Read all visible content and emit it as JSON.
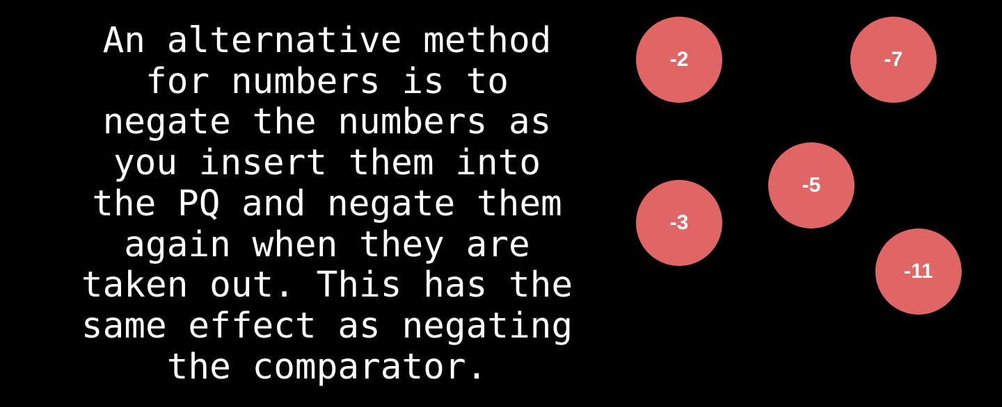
{
  "explanation": {
    "text": "An alternative method\nfor numbers is to\nnegate the numbers as\nyou insert them into\nthe PQ and negate them\nagain when they are\ntaken out. This has the\nsame effect as negating\nthe comparator."
  },
  "colors": {
    "background": "#000000",
    "text": "#ffffff",
    "node_fill": "#e06666",
    "node_label": "#ffffff"
  },
  "nodes": [
    {
      "label": "-2"
    },
    {
      "label": "-7"
    },
    {
      "label": "-5"
    },
    {
      "label": "-3"
    },
    {
      "label": "-11"
    }
  ]
}
